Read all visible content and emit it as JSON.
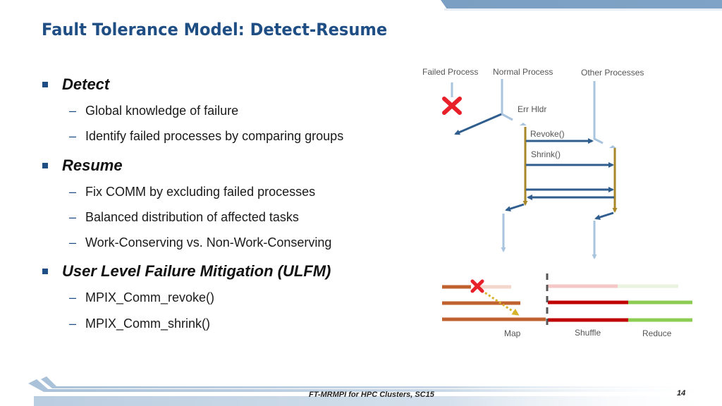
{
  "slide": {
    "title": "Fault Tolerance Model: Detect-Resume",
    "bullets": [
      {
        "label": "Detect",
        "sub": [
          "Global knowledge of failure",
          "Identify failed processes by comparing groups"
        ]
      },
      {
        "label": "Resume",
        "sub": [
          "Fix COMM by excluding failed processes",
          "Balanced distribution of affected tasks",
          "Work-Conserving vs. Non-Work-Conserving"
        ]
      },
      {
        "label": "User Level Failure Mitigation (ULFM)",
        "sub": [
          "MPIX_Comm_revoke()",
          "MPIX_Comm_shrink()"
        ]
      }
    ],
    "sub_dash": "–"
  },
  "diagram": {
    "process_labels": [
      "Failed Process",
      "Normal Process",
      "Other Processes"
    ],
    "err_handler_label": "Err Hldr",
    "calls": [
      "Revoke()",
      "Shrink()"
    ],
    "phase_labels": [
      "Map",
      "Shuffle",
      "Reduce"
    ],
    "colors": {
      "timeline_light": "#a9c4de",
      "arrow_dark": "#2f5e8e",
      "handler_gold": "#a8862a",
      "fail_red": "#e8202a",
      "map_orange": "#c0622f",
      "shuffle_red": "#c00000",
      "reduce_green": "#8ccc52",
      "migrate_dotted": "#d7b32c"
    }
  },
  "footer": {
    "text": "FT-MRMPI for HPC Clusters, SC15",
    "page_number": "14"
  }
}
